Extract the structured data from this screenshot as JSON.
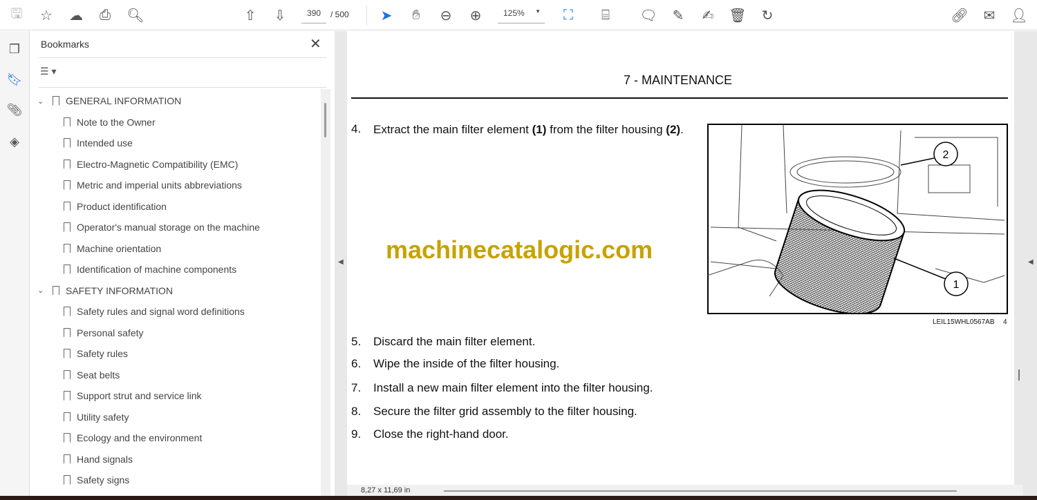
{
  "toolbar": {
    "page_current": "390",
    "page_total": "/ 500",
    "zoom": "125%",
    "icons": [
      "save-icon",
      "star-icon",
      "upload-cloud-icon",
      "print-icon",
      "find-icon",
      "page-up-icon",
      "page-down-icon",
      "select-cursor-icon",
      "hand-icon",
      "zoom-out-icon",
      "zoom-in-icon",
      "fit-page-icon",
      "scroll-mode-icon",
      "comment-icon",
      "highlight-icon",
      "sign-icon",
      "delete-icon",
      "rotate-icon",
      "share-link-icon",
      "email-icon",
      "account-icon"
    ]
  },
  "panel": {
    "title": "Bookmarks",
    "sections": [
      {
        "label": "GENERAL INFORMATION",
        "items": [
          "Note to the Owner",
          "Intended use",
          "Electro-Magnetic Compatibility (EMC)",
          "Metric and imperial units abbreviations",
          "Product identification",
          "Operator's manual storage on the machine",
          "Machine orientation",
          "Identification of machine components"
        ]
      },
      {
        "label": "SAFETY INFORMATION",
        "items": [
          "Safety rules and signal word definitions",
          "Personal safety",
          "Safety rules",
          "Seat belts",
          "Support strut and service link",
          "Utility safety",
          "Ecology and the environment",
          "Hand signals",
          "Safety signs"
        ]
      }
    ]
  },
  "document": {
    "header": "7 - MAINTENANCE",
    "step4_num": "4.",
    "step4_a": "Extract the main filter element ",
    "step4_b": "(1)",
    "step4_c": " from the filter housing ",
    "step4_d": "(2)",
    "step4_e": ".",
    "steps": [
      {
        "n": "5.",
        "t": "Discard the main filter element."
      },
      {
        "n": "6.",
        "t": "Wipe the inside of the filter housing."
      },
      {
        "n": "7.",
        "t": "Install a new main filter element into the filter housing."
      },
      {
        "n": "8.",
        "t": "Secure the filter grid assembly to the filter housing."
      },
      {
        "n": "9.",
        "t": "Close the right-hand door."
      }
    ],
    "watermark": "machinecatalogic.com",
    "figure_code": "LEIL15WHL0567AB",
    "figure_num": "4",
    "callout1": "1",
    "callout2": "2"
  },
  "status": {
    "page_size": "8,27 x 11,69 in"
  },
  "colors": {
    "accent": "#1473e6",
    "watermark": "#c8a200"
  }
}
